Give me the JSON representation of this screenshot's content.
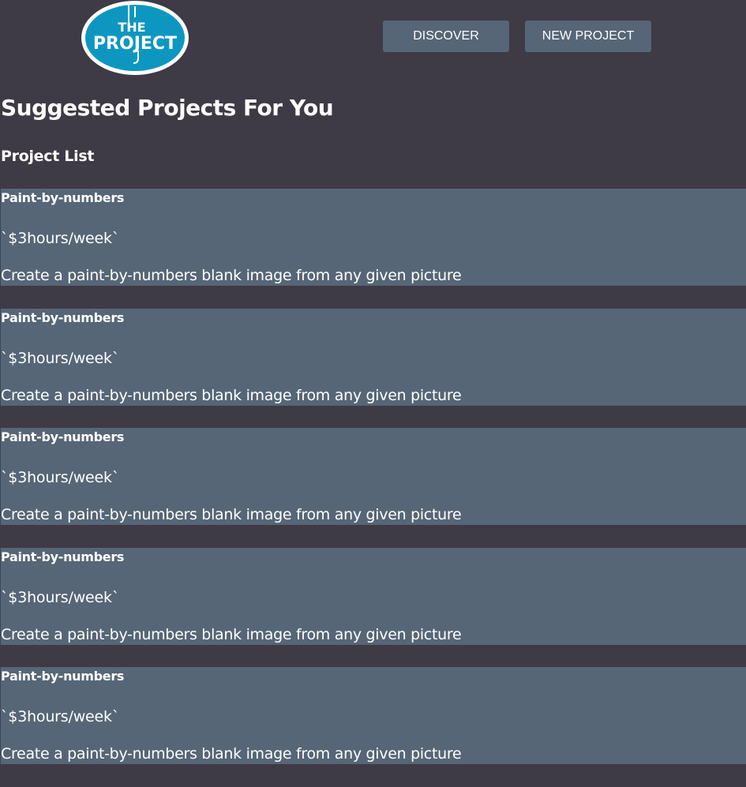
{
  "logo": {
    "line1": "THE",
    "line2": "PROJECT",
    "bg_color": "#0d97c0"
  },
  "nav": {
    "discover_label": "DISCOVER",
    "new_project_label": "NEW PROJECT"
  },
  "page": {
    "title": "Suggested Projects For You",
    "list_title": "Project List"
  },
  "projects": [
    {
      "name": "Paint-by-numbers",
      "time": "`$3hours/week`",
      "description": "Create a paint-by-numbers blank image from any given picture"
    },
    {
      "name": "Paint-by-numbers",
      "time": "`$3hours/week`",
      "description": "Create a paint-by-numbers blank image from any given picture"
    },
    {
      "name": "Paint-by-numbers",
      "time": "`$3hours/week`",
      "description": "Create a paint-by-numbers blank image from any given picture"
    },
    {
      "name": "Paint-by-numbers",
      "time": "`$3hours/week`",
      "description": "Create a paint-by-numbers blank image from any given picture"
    },
    {
      "name": "Paint-by-numbers",
      "time": "`$3hours/week`",
      "description": "Create a paint-by-numbers blank image from any given picture"
    }
  ],
  "colors": {
    "background": "#3e3a46",
    "card": "#566676",
    "button": "#566676",
    "text": "#ffffff"
  }
}
